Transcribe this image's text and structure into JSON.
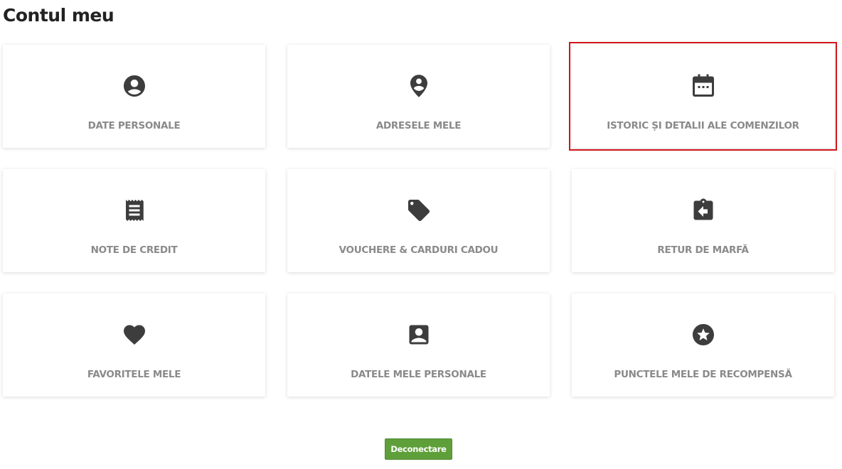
{
  "page": {
    "title": "Contul meu"
  },
  "cards": [
    {
      "label": "DATE PERSONALE",
      "icon": "account-circle-icon"
    },
    {
      "label": "ADRESELE MELE",
      "icon": "location-pin-icon"
    },
    {
      "label": "ISTORIC ȘI DETALII ALE COMENZILOR",
      "icon": "calendar-icon",
      "highlighted": true
    },
    {
      "label": "NOTE DE CREDIT",
      "icon": "receipt-icon"
    },
    {
      "label": "VOUCHERE & CARDURI CADOU",
      "icon": "tag-icon"
    },
    {
      "label": "RETUR DE MARFĂ",
      "icon": "assignment-return-icon"
    },
    {
      "label": "FAVORITELE MELE",
      "icon": "heart-icon"
    },
    {
      "label": "DATELE MELE PERSONALE",
      "icon": "contact-card-icon"
    },
    {
      "label": "PUNCTELE MELE DE RECOMPENSĂ",
      "icon": "star-circle-icon"
    }
  ],
  "logout": {
    "label": "Deconectare"
  },
  "colors": {
    "highlight_border": "#d0161b",
    "button_green": "#5e9f3a",
    "icon": "#3d3d3d",
    "label": "#8a8a8a"
  }
}
